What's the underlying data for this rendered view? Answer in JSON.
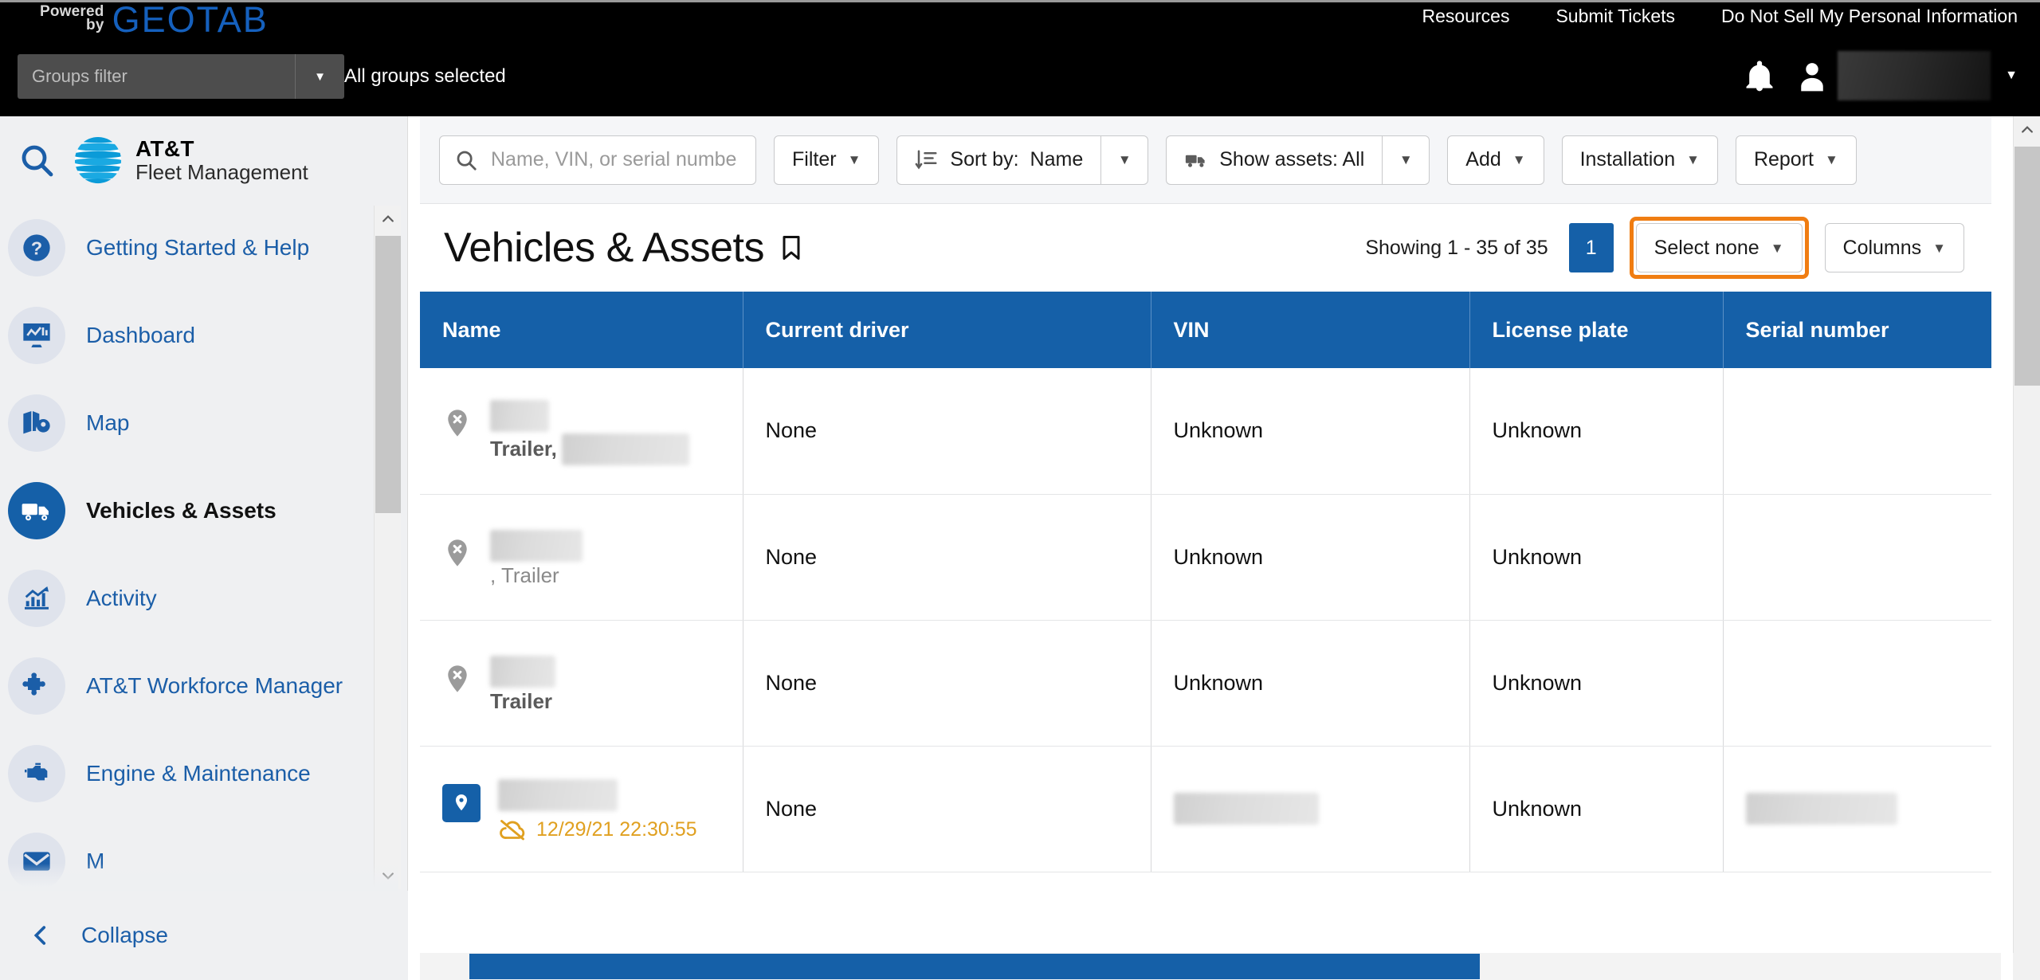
{
  "topbar": {
    "brand": {
      "powered_line1": "Powered",
      "powered_line2": "by",
      "name": "GEOTAB"
    },
    "nav": [
      {
        "label": "Resources"
      },
      {
        "label": "Submit Tickets"
      },
      {
        "label": "Do Not Sell My Personal Information"
      }
    ],
    "groups_filter_placeholder": "Groups filter",
    "groups_filter_value": "",
    "groups_selected_text": "All groups selected"
  },
  "sidebar": {
    "logo": {
      "line1": "AT&T",
      "line2": "Fleet Management"
    },
    "items": [
      {
        "label": "Getting Started & Help",
        "icon": "question-circle-icon",
        "chevron": true,
        "active": false
      },
      {
        "label": "Dashboard",
        "icon": "dashboard-icon",
        "chevron": false,
        "active": false
      },
      {
        "label": "Map",
        "icon": "map-icon",
        "chevron": true,
        "active": false
      },
      {
        "label": "Vehicles & Assets",
        "icon": "truck-icon",
        "chevron": false,
        "active": true
      },
      {
        "label": "Activity",
        "icon": "chart-icon",
        "chevron": true,
        "active": false
      },
      {
        "label": "AT&T Workforce Manager",
        "icon": "puzzle-icon",
        "chevron": false,
        "active": false
      },
      {
        "label": "Engine & Maintenance",
        "icon": "engine-icon",
        "chevron": true,
        "active": false
      }
    ],
    "collapse_label": "Collapse"
  },
  "toolbar": {
    "search_placeholder": "Name, VIN, or serial number",
    "search_value": "",
    "filter_label": "Filter",
    "sort_label": "Sort by:",
    "sort_value": "Name",
    "show_assets_label": "Show assets: All",
    "add_label": "Add",
    "installation_label": "Installation",
    "report_label": "Report"
  },
  "page": {
    "title": "Vehicles & Assets",
    "showing_text": "Showing 1 - 35 of 35",
    "page_number": "1",
    "select_none_label": "Select none",
    "columns_label": "Columns",
    "accent_highlight_color": "#f07d12",
    "header_blue": "#1560a8"
  },
  "table": {
    "columns": [
      "Name",
      "Current driver",
      "VIN",
      "License plate",
      "Serial number"
    ],
    "rows": [
      {
        "pin": "off",
        "name_redacted": true,
        "name_width": 74,
        "sub_prefix": "Trailer,",
        "sub_redacted_width": 160,
        "sub_suffix": "",
        "current_driver": "None",
        "vin": "Unknown",
        "vin_redacted": false,
        "license_plate": "Unknown",
        "serial_number": "",
        "serial_redacted": false,
        "timestamp": ""
      },
      {
        "pin": "off",
        "name_redacted": true,
        "name_width": 116,
        "sub_prefix": "",
        "sub_redacted_width": 0,
        "sub_suffix": ", Trailer",
        "current_driver": "None",
        "vin": "Unknown",
        "vin_redacted": false,
        "license_plate": "Unknown",
        "serial_number": "",
        "serial_redacted": false,
        "timestamp": ""
      },
      {
        "pin": "off",
        "name_redacted": true,
        "name_width": 82,
        "sub_prefix": "Trailer",
        "sub_redacted_width": 0,
        "sub_suffix": "",
        "current_driver": "None",
        "vin": "Unknown",
        "vin_redacted": false,
        "license_plate": "Unknown",
        "serial_number": "",
        "serial_redacted": false,
        "timestamp": ""
      },
      {
        "pin": "on",
        "name_redacted": true,
        "name_width": 150,
        "sub_prefix": "",
        "sub_redacted_width": 0,
        "sub_suffix": "",
        "current_driver": "None",
        "vin": "",
        "vin_redacted": true,
        "license_plate": "Unknown",
        "serial_number": "",
        "serial_redacted": true,
        "timestamp": "12/29/21 22:30:55"
      }
    ]
  }
}
